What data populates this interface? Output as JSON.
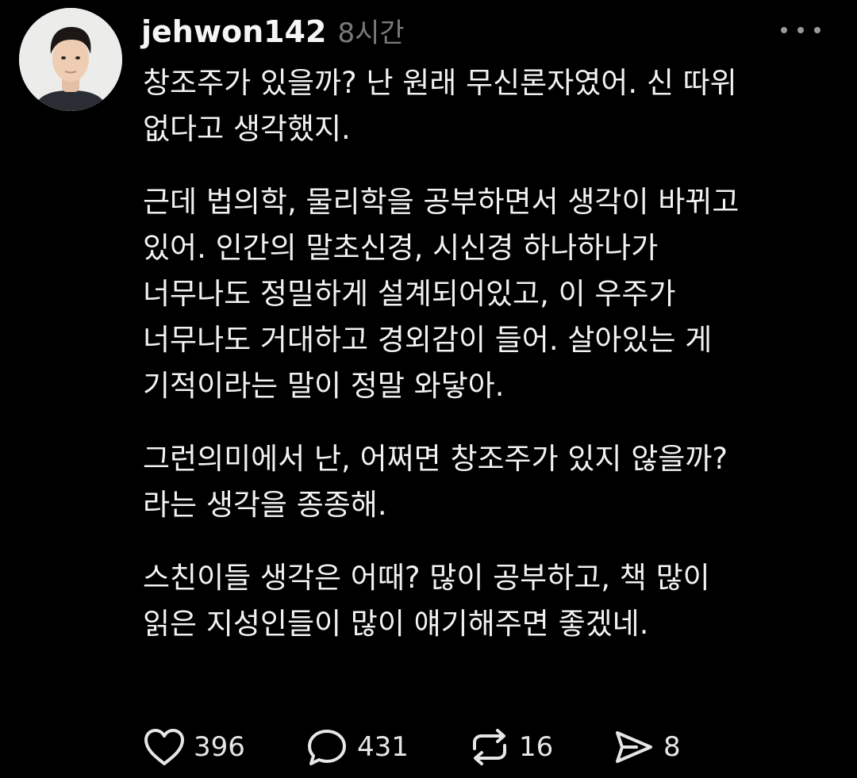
{
  "post": {
    "username": "jehwon142",
    "time": "8시간",
    "paragraphs": [
      [
        "창조주가 있을까? 난 원래 무신론자였어. 신 따위",
        "없다고 생각했지."
      ],
      [
        "근데 법의학, 물리학을 공부하면서 생각이 바뀌고",
        "있어. 인간의 말초신경, 시신경 하나하나가",
        "너무나도 정밀하게 설계되어있고, 이 우주가",
        "너무나도 거대하고 경외감이 들어. 살아있는 게",
        "기적이라는 말이 정말 와닿아."
      ],
      [
        "그런의미에서 난, 어쩌면 창조주가 있지 않을까?",
        "라는 생각을 종종해."
      ],
      [
        "스친이들 생각은 어때? 많이 공부하고, 책 많이",
        "읽은 지성인들이 많이 얘기해주면 좋겠네."
      ]
    ],
    "actions": {
      "like": {
        "icon": "heart-icon",
        "count": "396"
      },
      "comment": {
        "icon": "comment-icon",
        "count": "431"
      },
      "repost": {
        "icon": "repost-icon",
        "count": "16"
      },
      "share": {
        "icon": "send-icon",
        "count": "8"
      }
    }
  },
  "colors": {
    "background": "#000000",
    "text": "#f2f2f2",
    "muted": "#7a7a7a"
  }
}
